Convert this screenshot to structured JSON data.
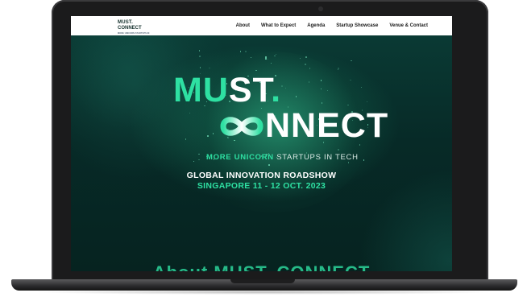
{
  "nav": {
    "logo": {
      "line1": "MUST.",
      "line2": "CONNECT",
      "tagline": "MORE UNICORN STARTUPS IN TECH"
    },
    "links": [
      "About",
      "What to Expect",
      "Agenda",
      "Startup Showcase",
      "Venue & Contact"
    ]
  },
  "hero": {
    "title_line1_accent": "MU",
    "title_line1_rest": "ST",
    "title_line1_dot": ".",
    "title_line2": "NNECT",
    "subtitle_accent": "MORE UNICORN",
    "subtitle_rest": " STARTUPS IN TECH",
    "roadshow": "GLOBAL INNOVATION ROADSHOW",
    "dates": "SINGAPORE 11 - 12 OCT. 2023",
    "next_section_heading": "About MUST. CONNECT"
  },
  "colors": {
    "accent": "#2ee0a2",
    "background": "#07201f",
    "nav_background": "#ffffff"
  },
  "icons": {
    "infinity": "infinity-logo-icon",
    "camera": "camera-icon"
  }
}
